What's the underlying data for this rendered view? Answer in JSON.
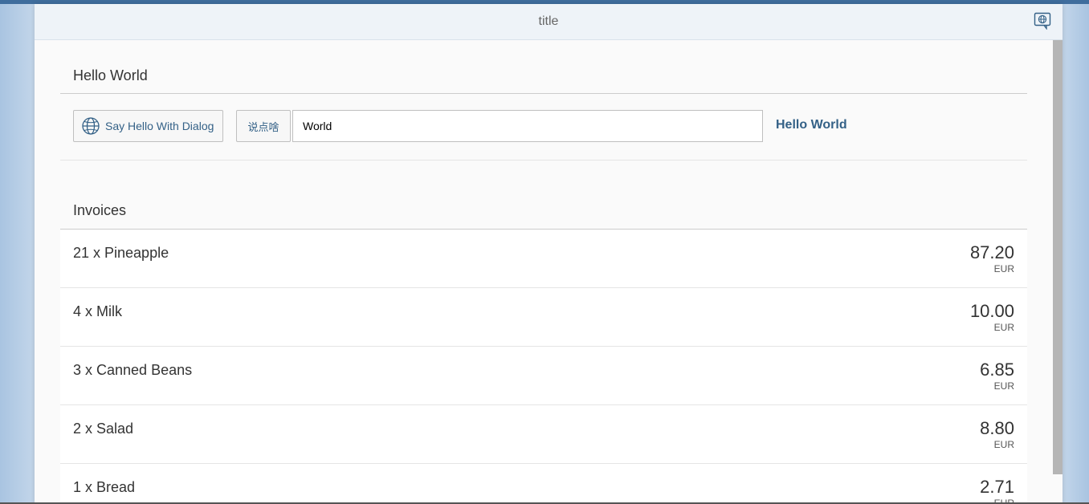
{
  "header": {
    "title": "title",
    "icon": "feedback-globe-icon"
  },
  "hello_panel": {
    "title": "Hello World",
    "dialog_button_label": "Say Hello With Dialog",
    "dialog_button_icon": "globe-icon",
    "say_button_label": "说点啥",
    "input_value": "World",
    "greeting_text": "Hello World"
  },
  "invoices": {
    "title": "Invoices",
    "items": [
      {
        "name": "21 x Pineapple",
        "amount": "87.20",
        "currency": "EUR"
      },
      {
        "name": "4 x Milk",
        "amount": "10.00",
        "currency": "EUR"
      },
      {
        "name": "3 x Canned Beans",
        "amount": "6.85",
        "currency": "EUR"
      },
      {
        "name": "2 x Salad",
        "amount": "8.80",
        "currency": "EUR"
      },
      {
        "name": "1 x Bread",
        "amount": "2.71",
        "currency": "EUR"
      }
    ]
  },
  "colors": {
    "accent": "#346187",
    "header_bg": "#eef3f8",
    "top_bar": "#3f6d9d"
  }
}
